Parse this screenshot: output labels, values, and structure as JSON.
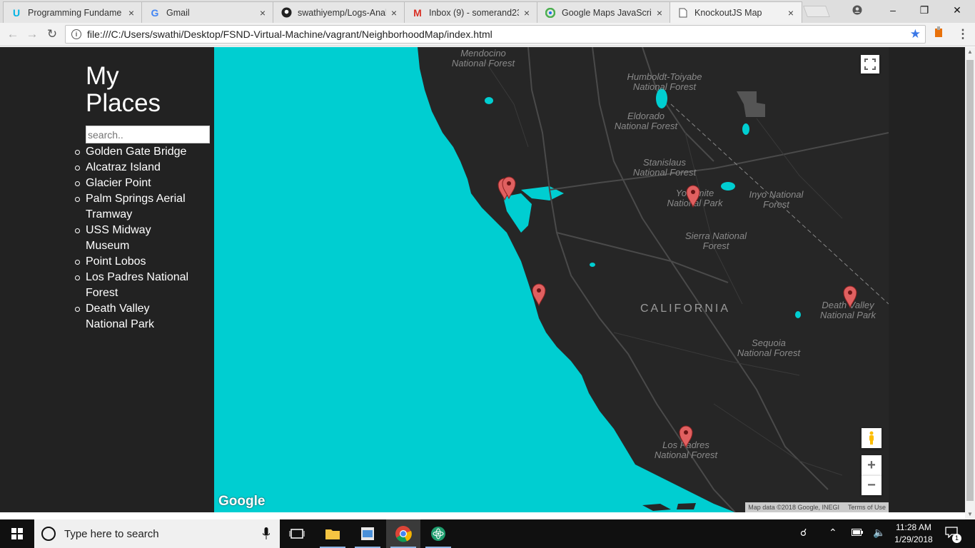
{
  "browser": {
    "tabs": [
      {
        "title": "Programming Fundame",
        "icon": "udacity-icon"
      },
      {
        "title": "Gmail",
        "icon": "google-icon"
      },
      {
        "title": "swathiyemp/Logs-Anal",
        "icon": "github-icon"
      },
      {
        "title": "Inbox (9) - somerand23",
        "icon": "gmail-icon"
      },
      {
        "title": "Google Maps JavaScrip",
        "icon": "google-maps-icon"
      },
      {
        "title": "KnockoutJS Map",
        "icon": "page-icon",
        "active": true
      }
    ],
    "url": "file:///C:/Users/swathi/Desktop/FSND-Virtual-Machine/vagrant/NeighborhoodMap/index.html"
  },
  "sidebar": {
    "title_line1": "My",
    "title_line2": "Places",
    "search_placeholder": "search..",
    "places": [
      "Golden Gate Bridge",
      "Alcatraz Island",
      "Glacier Point",
      "Palm Springs Aerial Tramway",
      "USS Midway Museum",
      "Point Lobos",
      "Los Padres National Forest",
      "Death Valley National Park"
    ]
  },
  "map": {
    "labels": {
      "mendocino": "Mendocino",
      "mendocino2": "National Forest",
      "humboldt": "Humboldt-Toiyabe",
      "humboldt2": "National Forest",
      "eldorado": "Eldorado",
      "eldorado2": "National Forest",
      "stanislaus": "Stanislaus",
      "stanislaus2": "National Forest",
      "yosemite": "Yosemite",
      "yosemite2": "National Park",
      "inyo": "Inyo National",
      "inyo2": "Forest",
      "sierra": "Sierra National",
      "sierra2": "Forest",
      "california": "CALIFORNIA",
      "deathvalley": "Death Valley",
      "deathvalley2": "National Park",
      "sequoia": "Sequoia",
      "sequoia2": "National Forest",
      "lospadres": "Los Padres",
      "lospadres2": "National Forest"
    },
    "logo": "Google",
    "attribution": "Map data ©2018 Google, INEGI",
    "terms": "Terms of Use",
    "zoom_in": "+",
    "zoom_out": "−",
    "water_color": "#00ced1",
    "land_color": "#262626"
  },
  "taskbar": {
    "search_placeholder": "Type here to search",
    "time": "11:28 AM",
    "date": "1/29/2018",
    "notification_count": "1"
  }
}
